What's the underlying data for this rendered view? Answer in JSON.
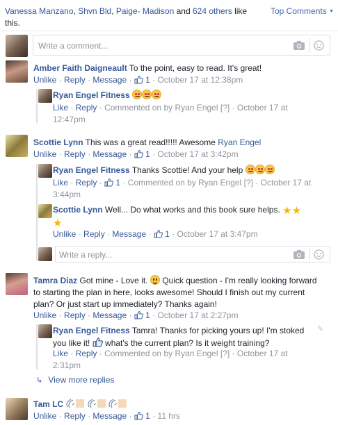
{
  "header": {
    "likers": [
      "Vanessa Manzano",
      "Shvn Bld",
      "Paige- Madison"
    ],
    "and_text": "and",
    "others_count": "624 others",
    "like_text": "like",
    "this_text": "this.",
    "sort_label": "Top Comments"
  },
  "composer": {
    "placeholder": "Write a comment..."
  },
  "actions": {
    "unlike": "Unlike",
    "like": "Like",
    "reply": "Reply",
    "message": "Message",
    "sep": "·",
    "commented_on_by": "Commented on by Ryan Engel",
    "bracket": "[?]"
  },
  "comments": [
    {
      "author": "Amber Faith Daigneault",
      "text": "To the point, easy to read. It's great!",
      "likes": "1",
      "time": "October 17 at 12:38pm",
      "replies": [
        {
          "author": "Ryan Engel Fitness",
          "time_line1": "October 17 at",
          "time_line2": "12:47pm"
        }
      ]
    },
    {
      "author": "Scottie Lynn",
      "text": "This was a great read!!!!! Awesome",
      "mention": "Ryan Engel",
      "likes": "1",
      "time": "October 17 at 3:42pm",
      "replies": [
        {
          "author": "Ryan Engel Fitness",
          "text": "Thanks Scottie! And your help",
          "likes": "1",
          "time_line1": "October 17 at",
          "time_line2": "3:44pm"
        },
        {
          "author": "Scottie Lynn",
          "text": "Well... Do what works and this book sure helps.",
          "likes": "1",
          "time": "October 17 at 3:47pm"
        }
      ],
      "reply_placeholder": "Write a reply..."
    },
    {
      "author": "Tamra Diaz",
      "text_lines": [
        "Got mine - Love it.",
        "Quick question - I'm really looking forward",
        "to starting the plan in here, looks awesome! Should I finish out my current",
        "plan? Or just start up immediately? Thanks again!"
      ],
      "likes": "1",
      "time": "October 17 at 2:27pm",
      "replies": [
        {
          "author": "Ryan Engel Fitness",
          "text_lines": [
            "Tamra! Thanks for picking yours up! I'm stoked",
            "you like it!",
            "what's the current plan? Is it weight training?"
          ],
          "time_line1": "October 17 at",
          "time_line2": "2:31pm"
        }
      ],
      "view_more": "View more replies"
    },
    {
      "author": "Tam LC",
      "likes": "1",
      "time": "11 hrs"
    }
  ],
  "colors": {
    "link": "#365899",
    "meta": "#90949c",
    "border": "#dddfe2",
    "sort": "#4267b2"
  }
}
